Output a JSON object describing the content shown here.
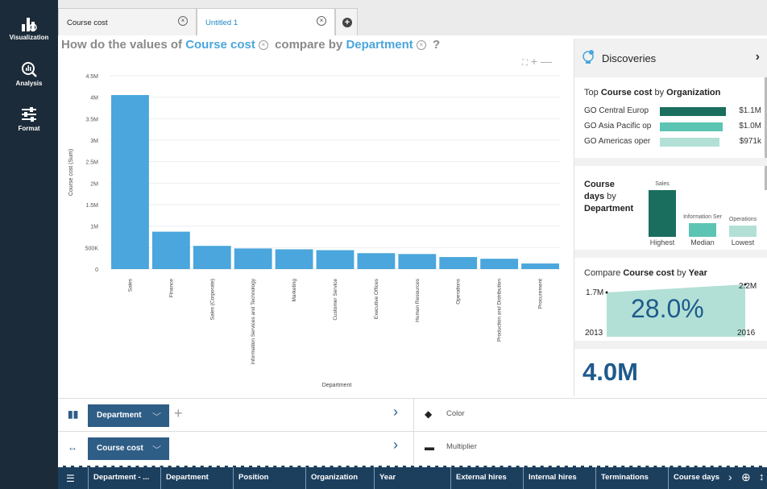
{
  "rail": {
    "items": [
      {
        "label": "Visualization",
        "icon": "visualization-icon"
      },
      {
        "label": "Analysis",
        "icon": "analysis-icon"
      },
      {
        "label": "Format",
        "icon": "format-icon"
      }
    ]
  },
  "tabs": [
    {
      "label": "Course cost",
      "active": false
    },
    {
      "label": "Untitled 1",
      "active": true
    }
  ],
  "question": {
    "prefix": "How do the values of",
    "measure": "Course cost",
    "middle": "compare by",
    "dimension": "Department",
    "suffix": "?"
  },
  "chart_data": {
    "type": "bar",
    "categories": [
      "Sales",
      "Finance",
      "Sales (Corporate)",
      "Information Services and Technology",
      "Marketing",
      "Customer Service",
      "Executive Offices",
      "Human Resources",
      "Operations",
      "Production and Distribution",
      "Procurement"
    ],
    "values": [
      4050000,
      870000,
      540000,
      480000,
      460000,
      440000,
      370000,
      350000,
      280000,
      240000,
      130000
    ],
    "ylim": [
      0,
      4500000
    ],
    "yticks": [
      "0",
      "500K",
      "1M",
      "1.5M",
      "2M",
      "2.5M",
      "3M",
      "3.5M",
      "4M",
      "4.5M"
    ],
    "ylabel": "Course cost (Sum)",
    "xlabel": "Department",
    "color": "#4aa6dc",
    "grid": true
  },
  "discoveries": {
    "title": "Discoveries",
    "top_card": {
      "prefix": "Top",
      "measure": "Course cost",
      "by": "by",
      "dimension": "Organization",
      "rows": [
        {
          "label": "GO Central Europ",
          "value": "$1.1M",
          "share": 1.0,
          "color": "#1a6e5e"
        },
        {
          "label": "GO Asia Pacific op",
          "value": "$1.0M",
          "share": 0.95,
          "color": "#5cc4b2"
        },
        {
          "label": "GO Americas oper",
          "value": "$971k",
          "share": 0.9,
          "color": "#b2e0d6"
        }
      ]
    },
    "days_card": {
      "measure": "Course",
      "measure2": "days",
      "by": "by",
      "dimension": "Department",
      "bars": [
        {
          "label": "Sales",
          "caption": "Highest",
          "share": 1.0,
          "color": "#1a6e5e"
        },
        {
          "label": "Information Ser",
          "caption": "Median",
          "share": 0.3,
          "color": "#5cc4b2"
        },
        {
          "label": "Operations",
          "caption": "Lowest",
          "share": 0.25,
          "color": "#b2e0d6"
        }
      ]
    },
    "compare_card": {
      "prefix": "Compare",
      "measure": "Course cost",
      "by": "by",
      "dimension": "Year",
      "start_value": "1.7M",
      "end_value": "2.2M",
      "start_year": "2013",
      "end_year": "2016",
      "percent": "28.0%"
    },
    "total": "4.0M"
  },
  "zones": {
    "row1": {
      "chip": "Department",
      "right_label": "Color"
    },
    "row2": {
      "chip": "Course cost",
      "right_label": "Multiplier"
    }
  },
  "columns": [
    "Department - ...",
    "Department",
    "Position",
    "Organization",
    "Year",
    "External hires",
    "Internal hires",
    "Terminations",
    "Course days"
  ]
}
